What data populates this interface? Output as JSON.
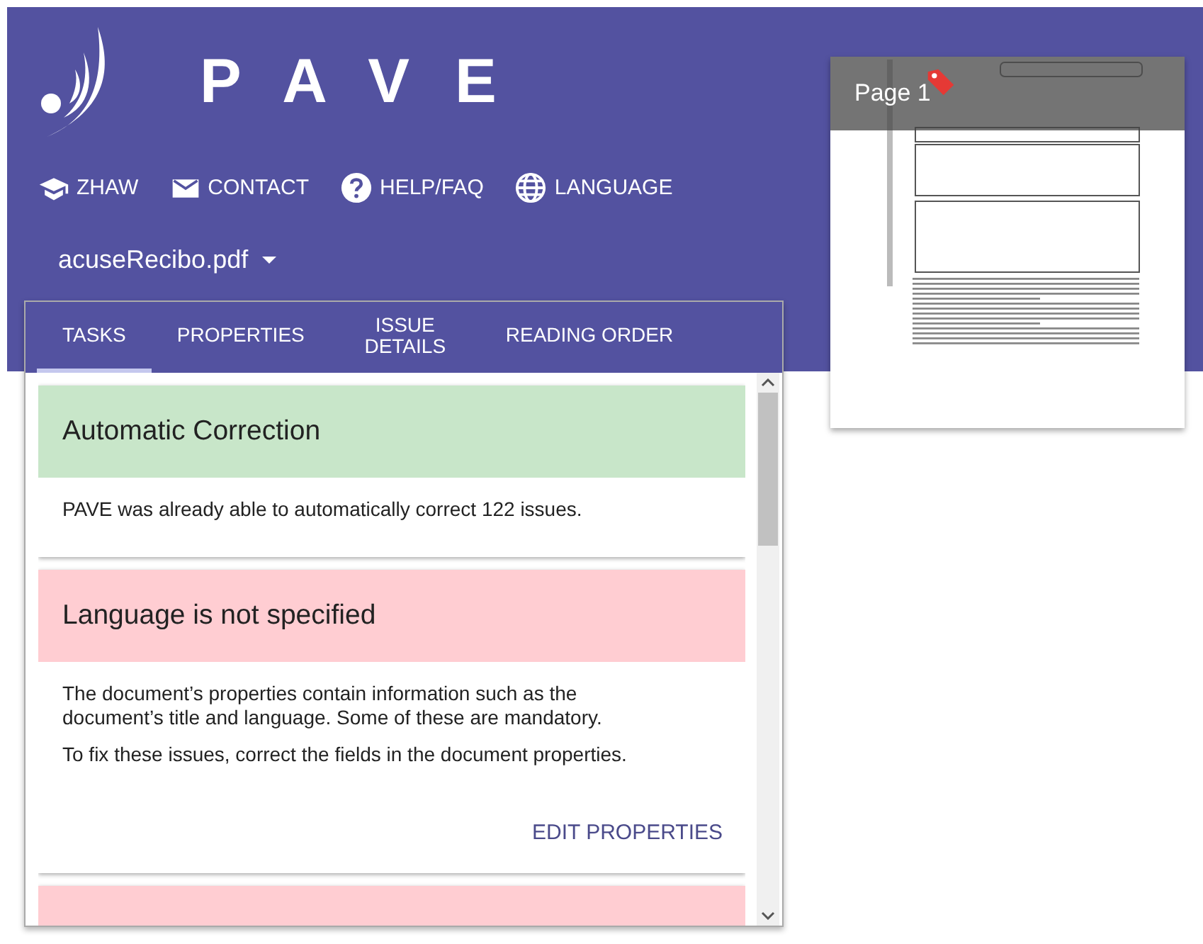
{
  "app": {
    "title": "PAVE"
  },
  "nav": [
    {
      "kind": "school",
      "label": "ZHAW"
    },
    {
      "kind": "mail",
      "label": "CONTACT"
    },
    {
      "kind": "help",
      "label": "HELP/FAQ"
    },
    {
      "kind": "globe",
      "label": "LANGUAGE"
    }
  ],
  "file_select": {
    "value": "acuseRecibo.pdf"
  },
  "tabs": [
    {
      "label": "TASKS",
      "selected": true
    },
    {
      "label": "PROPERTIES",
      "selected": false
    },
    {
      "label": "ISSUE DETAILS",
      "selected": false
    },
    {
      "label": "READING ORDER",
      "selected": false
    }
  ],
  "cards": [
    {
      "kind": "success",
      "title": "Automatic Correction",
      "paragraphs": [
        "PAVE was already able to automatically correct 122 issues."
      ]
    },
    {
      "kind": "error",
      "title": "Language is not specified",
      "paragraphs": [
        "The document’s properties contain information such as the document’s title and language. Some of these are mandatory.",
        "To fix these issues, correct the fields in the document properties."
      ],
      "action": "EDIT PROPERTIES"
    },
    {
      "kind": "error"
    }
  ],
  "page_preview": {
    "label": "Page 1"
  }
}
